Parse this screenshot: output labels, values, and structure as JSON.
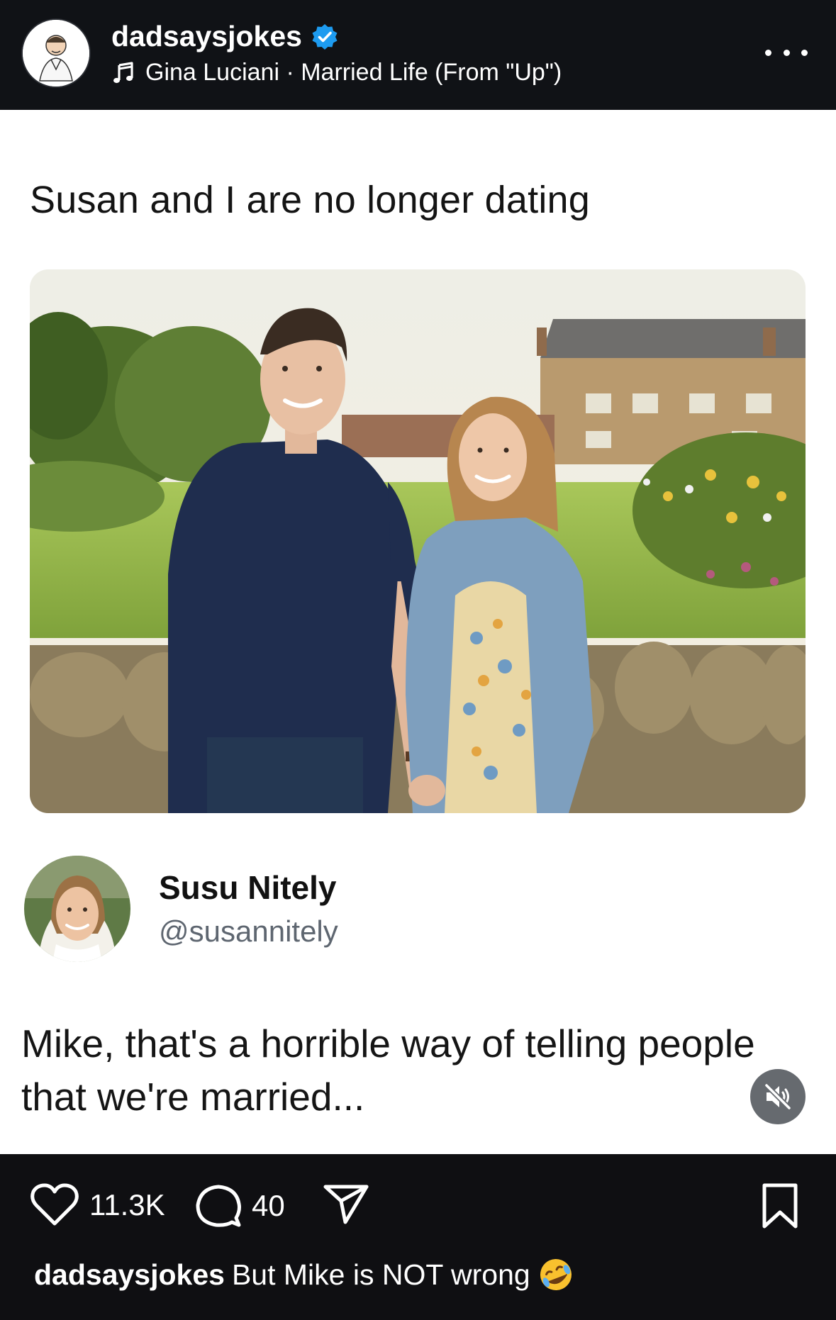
{
  "header": {
    "username": "dadsaysjokes",
    "music": "Gina Luciani · Married Life (From \"Up\")"
  },
  "post": {
    "top_caption": "Susan and I are no longer dating",
    "reply": {
      "name": "Susu Nitely",
      "handle": "@susannitely",
      "text": "Mike, that's a horrible way of telling people that we're married..."
    }
  },
  "actions": {
    "likes": "11.3K",
    "comments": "40"
  },
  "caption": {
    "username": "dadsaysjokes",
    "text": "But Mike is NOT wrong"
  },
  "colors": {
    "verified": "#1d9bf0",
    "header_bg": "#101216",
    "post_bg": "#ffffff",
    "mute_bg": "#666a6f"
  },
  "icons": [
    "music-icon",
    "verified-icon",
    "more-icon",
    "mute-icon",
    "heart-icon",
    "comment-icon",
    "share-icon",
    "bookmark-icon",
    "rofl-emoji-icon"
  ]
}
